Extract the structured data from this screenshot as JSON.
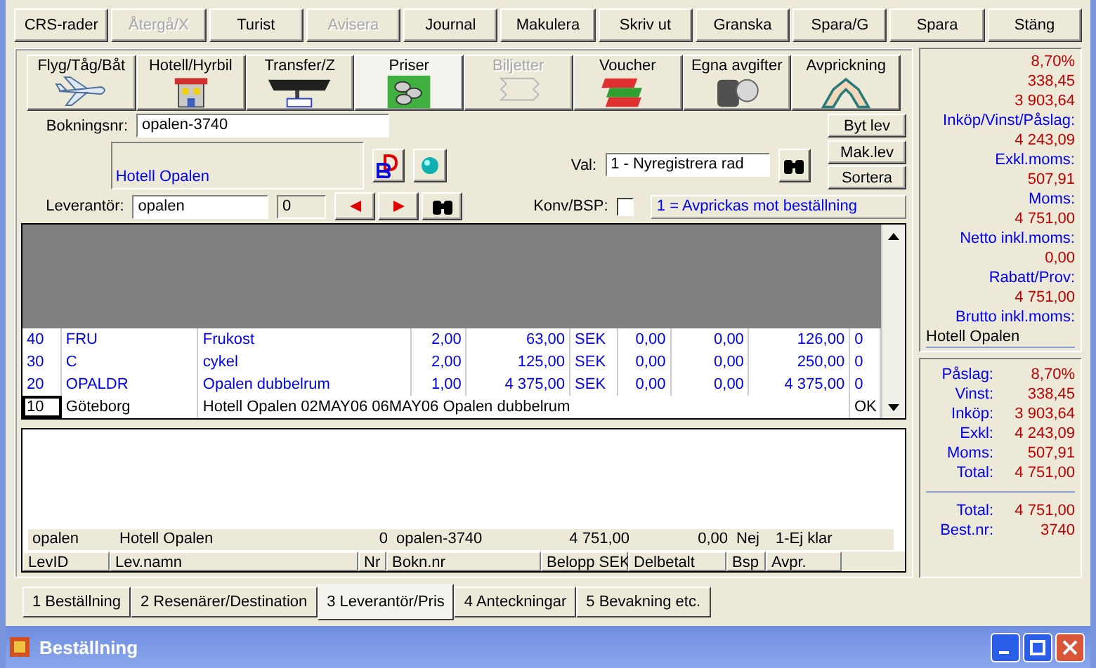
{
  "toolbar": [
    {
      "label": "CRS-rader",
      "disabled": false
    },
    {
      "label": "Återgå/X",
      "disabled": true
    },
    {
      "label": "Turist",
      "disabled": false
    },
    {
      "label": "Avisera",
      "disabled": true
    },
    {
      "label": "Journal",
      "disabled": false
    },
    {
      "label": "Makulera",
      "disabled": false
    },
    {
      "label": "Skriv ut",
      "disabled": false
    },
    {
      "label": "Granska",
      "disabled": false
    },
    {
      "label": "Spara/G",
      "disabled": false
    },
    {
      "label": "Spara",
      "disabled": false
    },
    {
      "label": "Stäng",
      "disabled": false
    }
  ],
  "icon_tabs": [
    {
      "label": "Flyg/Tåg/Båt",
      "kind": "plane",
      "disabled": false,
      "selected": false
    },
    {
      "label": "Hotell/Hyrbil",
      "kind": "hotel",
      "disabled": false,
      "selected": false
    },
    {
      "label": "Transfer/Z",
      "kind": "bus",
      "disabled": false,
      "selected": false
    },
    {
      "label": "Priser",
      "kind": "coins",
      "disabled": false,
      "selected": true
    },
    {
      "label": "Biljetter",
      "kind": "tickets",
      "disabled": true,
      "selected": false
    },
    {
      "label": "Voucher",
      "kind": "vouchers",
      "disabled": false,
      "selected": false
    },
    {
      "label": "Egna avgifter",
      "kind": "stack",
      "disabled": false,
      "selected": false
    },
    {
      "label": "Avprickning",
      "kind": "hands",
      "disabled": false,
      "selected": false
    }
  ],
  "form": {
    "booking_label": "Bokningsnr:",
    "booking_value": "opalen-3740",
    "supplier_name": "Hotell Opalen",
    "val_label": "Val:",
    "val_value": "1 - Nyregistrera rad",
    "side_buttons": [
      "Byt lev",
      "Mak.lev",
      "Sortera"
    ],
    "supplier_label": "Leverantör:",
    "supplier_value": "opalen",
    "count_value": "0",
    "konv_label": "Konv/BSP:",
    "konv_checked": false,
    "hint": "1 = Avprickas mot beställning"
  },
  "grid_rows": [
    {
      "selected": false,
      "cells": [
        "40",
        "FRU",
        "Frukost",
        "2,00",
        "63,00",
        "SEK",
        "0,00",
        "0,00",
        "126,00",
        "0"
      ]
    },
    {
      "selected": false,
      "cells": [
        "30",
        "C",
        "cykel",
        "2,00",
        "125,00",
        "SEK",
        "0,00",
        "0,00",
        "250,00",
        "0"
      ]
    },
    {
      "selected": false,
      "cells": [
        "20",
        "OPALDR",
        "Opalen dubbelrum",
        "1,00",
        "4 375,00",
        "SEK",
        "0,00",
        "0,00",
        "4 375,00",
        "0"
      ]
    },
    {
      "selected": true,
      "cells": [
        "10",
        "Göteborg",
        "Hotell Opalen 02MAY06 06MAY06  Opalen dubbelrum",
        "",
        "",
        "",
        "",
        "",
        "",
        "OK"
      ]
    }
  ],
  "summary_row": [
    "opalen",
    "Hotell Opalen",
    "0",
    "opalen-3740",
    "4 751,00",
    "0,00",
    "Nej",
    "1-Ej klar"
  ],
  "summary_columns": [
    "LevID",
    "Lev.namn",
    "Nr",
    "Bokn.nr",
    "Belopp SEK",
    "Delbetalt",
    "Bsp",
    "Avpr."
  ],
  "totals_panel": [
    {
      "kind": "value",
      "text": "8,70%"
    },
    {
      "kind": "value",
      "text": "338,45"
    },
    {
      "kind": "value",
      "text": "3 903,64"
    },
    {
      "kind": "label",
      "text": "Inköp/Vinst/Påslag:"
    },
    {
      "kind": "value",
      "text": "4 243,09"
    },
    {
      "kind": "label",
      "text": "Exkl.moms:"
    },
    {
      "kind": "value",
      "text": "507,91"
    },
    {
      "kind": "label",
      "text": "Moms:"
    },
    {
      "kind": "value",
      "text": "4 751,00"
    },
    {
      "kind": "label",
      "text": "Netto inkl.moms:"
    },
    {
      "kind": "value",
      "text": "0,00"
    },
    {
      "kind": "label",
      "text": "Rabatt/Prov:"
    },
    {
      "kind": "value",
      "text": "4 751,00"
    },
    {
      "kind": "label",
      "text": "Brutto inkl.moms:"
    },
    {
      "kind": "name",
      "text": "Hotell Opalen"
    }
  ],
  "summary_panel": [
    {
      "label": "Påslag:",
      "value": "8,70%"
    },
    {
      "label": "Vinst:",
      "value": "338,45"
    },
    {
      "label": "Inköp:",
      "value": "3 903,64"
    },
    {
      "label": "Exkl:",
      "value": "4 243,09"
    },
    {
      "label": "Moms:",
      "value": "507,91"
    },
    {
      "label": "Total:",
      "value": "4 751,00"
    }
  ],
  "order_panel": [
    {
      "label": "Total:",
      "value": "4 751,00"
    },
    {
      "label": "Best.nr:",
      "value": "3740"
    }
  ],
  "bottom_tabs": [
    {
      "label": "1 Beställning",
      "selected": false
    },
    {
      "label": "2 Resenärer/Destination",
      "selected": false
    },
    {
      "label": "3 Leverantör/Pris",
      "selected": true
    },
    {
      "label": "4 Anteckningar",
      "selected": false
    },
    {
      "label": "5 Bevakning etc.",
      "selected": false
    }
  ],
  "window": {
    "title": "Beställning"
  }
}
